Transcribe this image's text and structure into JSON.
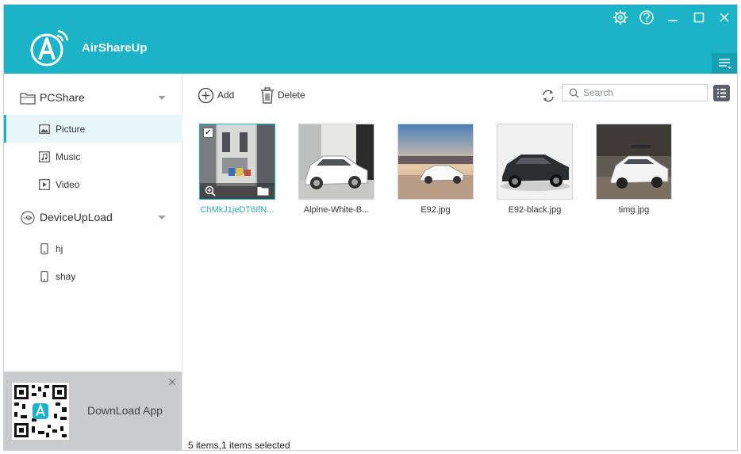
{
  "app": {
    "name": "AirShareUp"
  },
  "sidebar": {
    "groups": [
      {
        "label": "PCShare",
        "items": [
          {
            "label": "Picture"
          },
          {
            "label": "Music"
          },
          {
            "label": "Video"
          }
        ]
      },
      {
        "label": "DeviceUpLoad",
        "items": [
          {
            "label": "hj"
          },
          {
            "label": "shay"
          }
        ]
      }
    ],
    "download": {
      "label": "DownLoad App"
    }
  },
  "toolbar": {
    "add_label": "Add",
    "delete_label": "Delete",
    "search_placeholder": "Search"
  },
  "files": [
    {
      "name": "ChMkJ1jeDT6IfN...",
      "selected": true
    },
    {
      "name": "Alpine-White-B...",
      "selected": false
    },
    {
      "name": "E92.jpg",
      "selected": false
    },
    {
      "name": "E92-black.jpg",
      "selected": false
    },
    {
      "name": "timg.jpg",
      "selected": false
    }
  ],
  "status": {
    "text": "5 items,1 items selected"
  },
  "colors": {
    "accent": "#1bb3c8",
    "selected_text": "#2bb0a8"
  }
}
